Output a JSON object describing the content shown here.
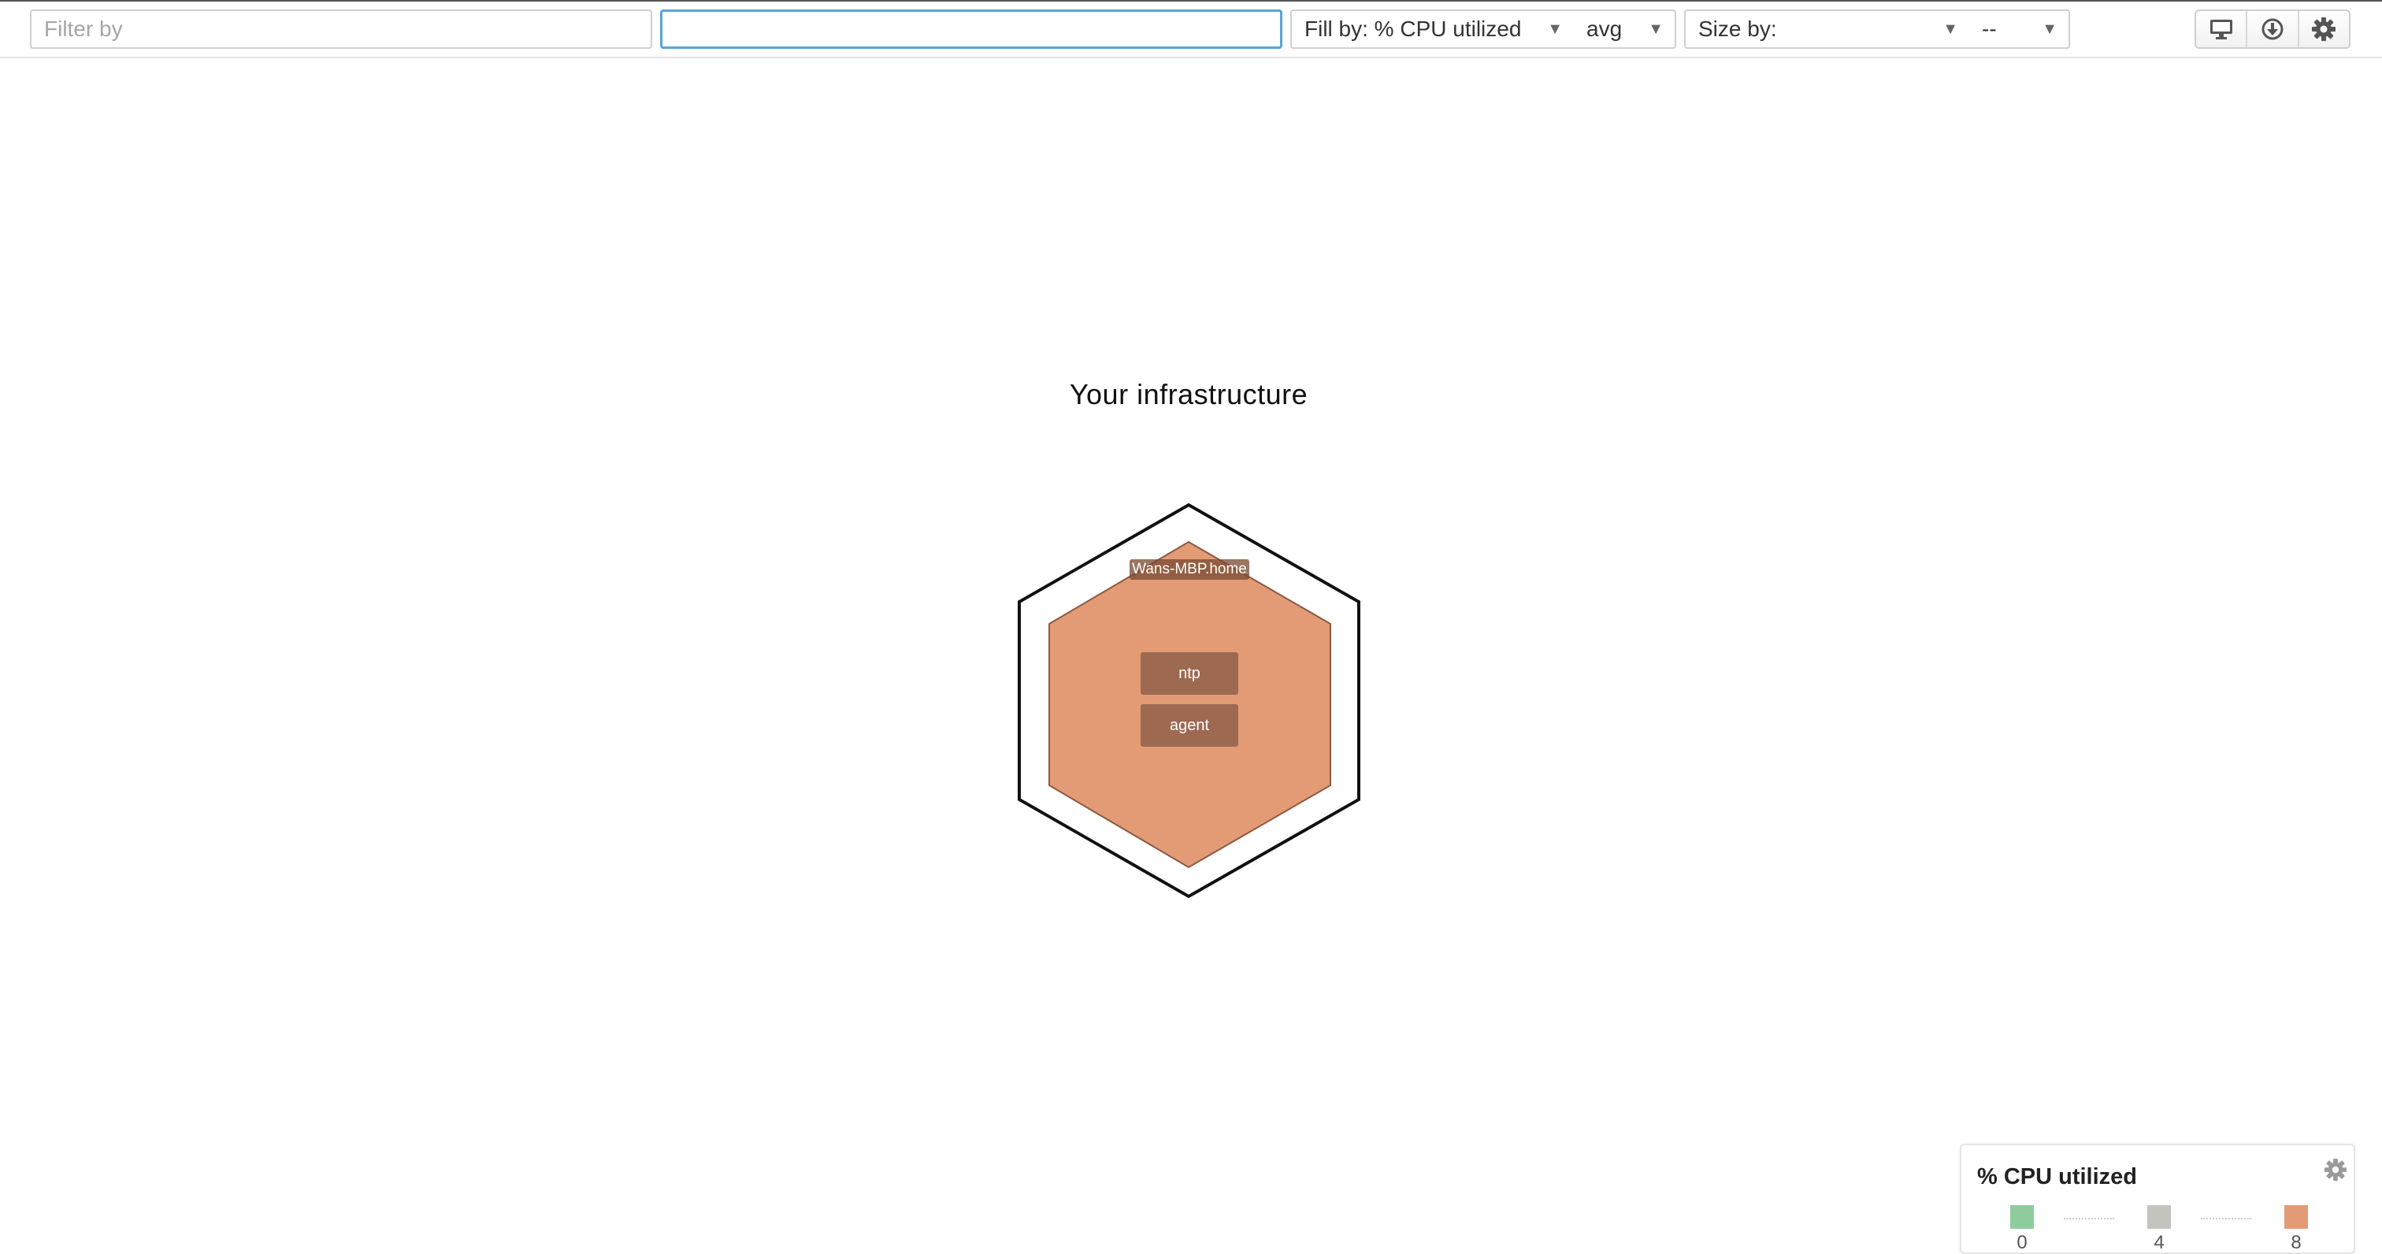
{
  "toolbar": {
    "filter_placeholder": "Filter by",
    "group_value": "",
    "fill_by_label": "Fill by: % CPU utilized",
    "fill_agg_label": "avg",
    "size_by_label": "Size by:",
    "size_agg_label": "--",
    "buttons": [
      {
        "icon": "monitor-icon"
      },
      {
        "icon": "download-icon"
      },
      {
        "icon": "gear-icon"
      }
    ]
  },
  "map": {
    "title": "Your infrastructure",
    "group": {
      "host": {
        "name": "Wans-MBP.home",
        "fill_color": "#e39b76",
        "apps": [
          "ntp",
          "agent"
        ]
      }
    }
  },
  "legend": {
    "title": "% CPU utilized",
    "stops": [
      {
        "value": "0",
        "color": "#8fcc9d"
      },
      {
        "value": "4",
        "color": "#c4c4bd"
      },
      {
        "value": "8",
        "color": "#e39b76"
      }
    ]
  }
}
